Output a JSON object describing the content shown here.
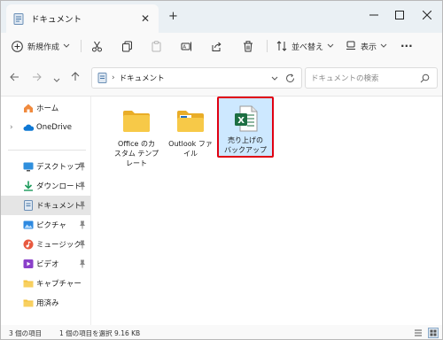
{
  "window": {
    "tab_title": "ドキュメント",
    "new_tab": "+",
    "close_tab": "✕"
  },
  "toolbar": {
    "new_label": "新規作成",
    "sort_label": "並べ替え",
    "view_label": "表示",
    "more_label": "···"
  },
  "address": {
    "location": "ドキュメント",
    "search_placeholder": "ドキュメントの検索"
  },
  "sidebar": {
    "items": [
      {
        "label": "ホーム",
        "icon": "home-icon"
      },
      {
        "label": "OneDrive",
        "icon": "cloud-icon"
      },
      {
        "label": "デスクトップ",
        "icon": "desktop-icon"
      },
      {
        "label": "ダウンロード",
        "icon": "download-icon"
      },
      {
        "label": "ドキュメント",
        "icon": "document-icon"
      },
      {
        "label": "ピクチャ",
        "icon": "pictures-icon"
      },
      {
        "label": "ミュージック",
        "icon": "music-icon"
      },
      {
        "label": "ビデオ",
        "icon": "video-icon"
      },
      {
        "label": "キャプチャー",
        "icon": "folder-icon"
      },
      {
        "label": "用済み",
        "icon": "folder-icon"
      }
    ]
  },
  "files": [
    {
      "name": "Office のカスタム テンプレート",
      "line1": "Office のカ",
      "line2": "スタム テンプ",
      "line3": "レート",
      "type": "folder"
    },
    {
      "name": "Outlook ファイル",
      "line1": "Outlook ファ",
      "line2": "イル",
      "type": "folder"
    },
    {
      "name": "売り上げのバックアップ",
      "line1": "売り上げの",
      "line2": "バックアップ",
      "type": "excel",
      "selected": true
    }
  ],
  "status": {
    "count": "3 個の項目",
    "selection": "1 個の項目を選択  9.16 KB"
  },
  "colors": {
    "accent": "#0067c0",
    "selection": "#cde8ff",
    "highlight_frame": "#e00012",
    "folder": "#f5c342",
    "excel": "#1d6f42"
  }
}
